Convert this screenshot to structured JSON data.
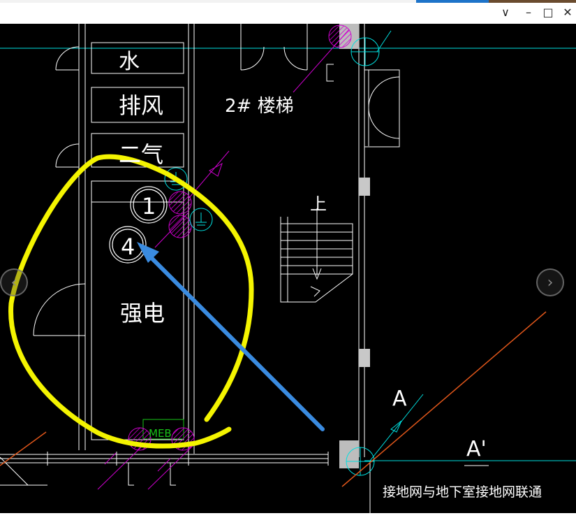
{
  "window": {
    "minimize_glyph": "–",
    "maximize_glyph": "□",
    "close_glyph": "✕",
    "dropdown_glyph": "∨"
  },
  "drawing": {
    "rooms": {
      "water": "水",
      "exhaust": "排风",
      "gas": "二气",
      "stair": "2# 楼梯",
      "power": "强电"
    },
    "stair_up": "上",
    "markers": {
      "m1": "1",
      "m4": "4"
    },
    "meb_label": "MEB",
    "section_a": "A",
    "section_a_prime": "A'",
    "note": "接地网与地下室接地网联通"
  },
  "viewer": {
    "prev_glyph": "‹",
    "next_glyph": "›"
  },
  "colors": {
    "accent": "#1d73c9",
    "annotation_yellow": "#f4f400",
    "annotation_blue": "#3a8be0",
    "cad_white": "#ffffff",
    "cad_cyan": "#00e0e0",
    "cad_magenta": "#d000d0",
    "cad_orange": "#e0561a",
    "cad_green": "#19c419"
  }
}
